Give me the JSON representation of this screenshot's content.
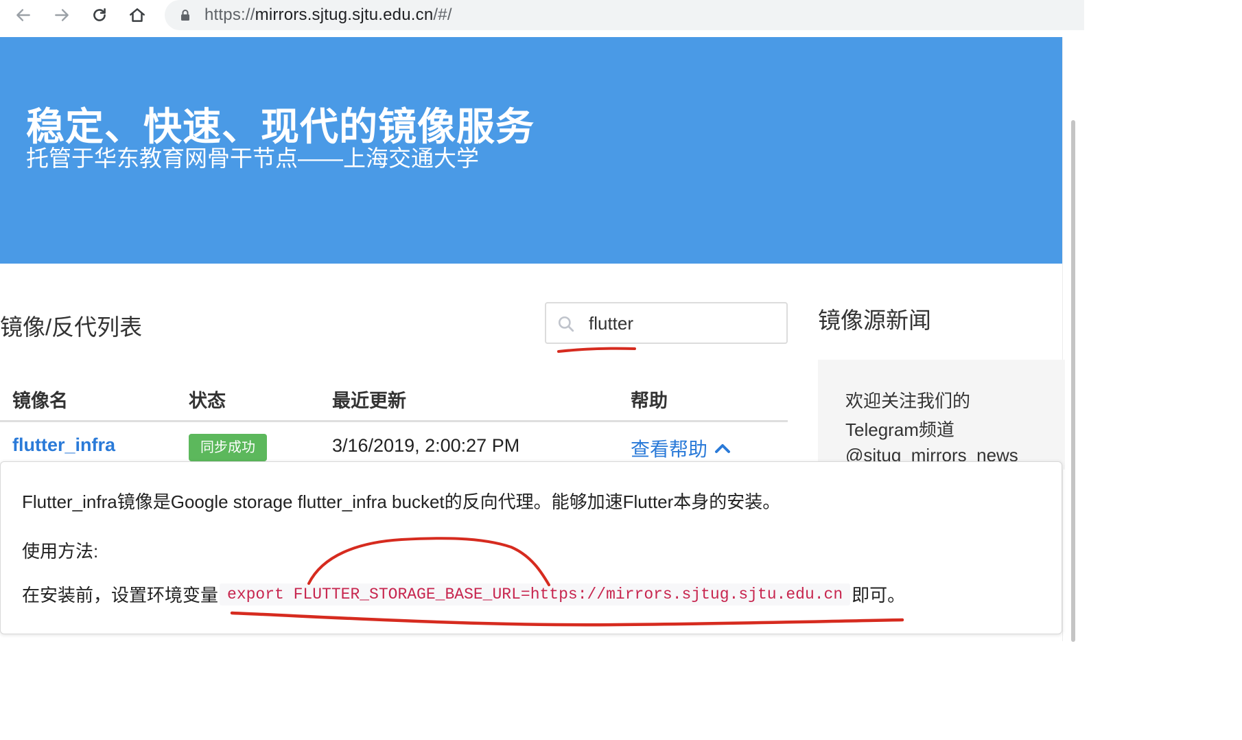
{
  "browser": {
    "url_scheme": "https://",
    "url_host": "mirrors.sjtug.sjtu.edu.cn",
    "url_path": "/#/",
    "icons": [
      "back-icon",
      "forward-icon",
      "reload-icon",
      "home-icon",
      "lock-icon"
    ]
  },
  "hero": {
    "title": "稳定、快速、现代的镜像服务",
    "subtitle": "托管于华东教育网骨干节点——上海交通大学",
    "background_color": "#4a9ae6"
  },
  "mirrors": {
    "section_title": "镜像/反代列表",
    "search": {
      "value": "flutter",
      "icon": "search-icon"
    },
    "columns": [
      "镜像名",
      "状态",
      "最近更新",
      "帮助"
    ],
    "rows": [
      {
        "name": "flutter_infra",
        "status": "同步成功",
        "status_color": "#5cb85c",
        "updated": "3/16/2019, 2:00:27 PM",
        "help": "查看帮助",
        "help_icon": "chevron-up-icon"
      }
    ]
  },
  "news": {
    "title": "镜像源新闻",
    "lines": [
      "欢迎关注我们的",
      "Telegram频道",
      "@sjtug_mirrors_news"
    ]
  },
  "help_popover": {
    "description": "Flutter_infra镜像是Google storage flutter_infra bucket的反向代理。能够加速Flutter本身的安装。",
    "usage_label": "使用方法:",
    "instruction_prefix": "在安装前，设置环境变量",
    "command": "export FLUTTER_STORAGE_BASE_URL=https://mirrors.sjtug.sjtu.edu.cn",
    "instruction_suffix": "即可。"
  },
  "colors": {
    "link": "#2a7ad8",
    "code_text": "#c7254e",
    "annotation": "#d62b1f"
  }
}
